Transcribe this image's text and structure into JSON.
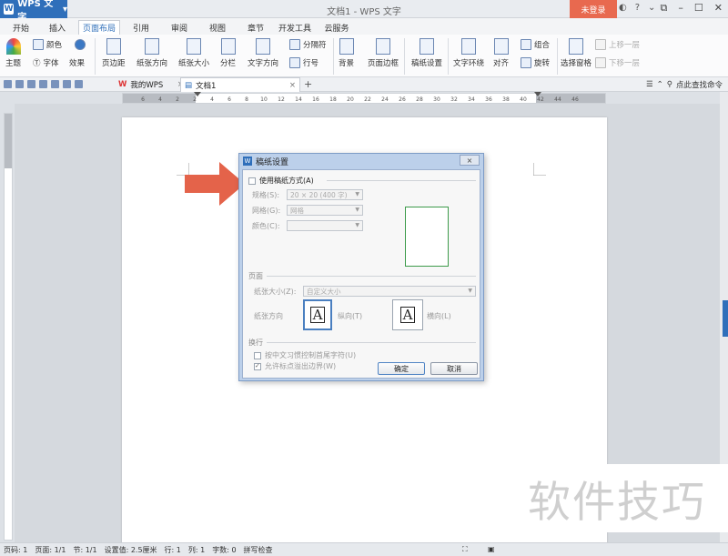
{
  "app": {
    "name": "WPS 文字",
    "window_title": "文档1 - WPS 文字",
    "login": "未登录"
  },
  "menu": {
    "tabs": [
      "开始",
      "插入",
      "页面布局",
      "引用",
      "审阅",
      "视图",
      "章节",
      "开发工具",
      "云服务"
    ],
    "active": "页面布局"
  },
  "ribbon": {
    "theme": "主题",
    "colors": "颜色",
    "fonts": "字体",
    "effects": "效果",
    "margins": "页边距",
    "orientation": "纸张方向",
    "size": "纸张大小",
    "columns": "分栏",
    "text_direction": "文字方向",
    "page_break": "分隔符",
    "line_numbers": "行号",
    "background": "背景",
    "page_border": "页面边框",
    "draft_paper": "稿纸设置",
    "wrap_text": "文字环绕",
    "align": "对齐",
    "group": "组合",
    "rotate": "旋转",
    "selection_pane": "选择窗格",
    "bring_forward": "上移一层",
    "send_backward": "下移一层"
  },
  "tabs_bar": {
    "mywps": "我的WPS",
    "doc": "文档1",
    "search_cmd": "点此查找命令"
  },
  "ruler_labels": [
    "6",
    "4",
    "2",
    "2",
    "4",
    "6",
    "8",
    "10",
    "12",
    "14",
    "16",
    "18",
    "20",
    "22",
    "24",
    "26",
    "28",
    "30",
    "32",
    "34",
    "36",
    "38",
    "40",
    "42",
    "44",
    "46"
  ],
  "dialog": {
    "title": "稿纸设置",
    "use_paper": "使用稿纸方式(A)",
    "spec_label": "规格(S):",
    "spec_value": "20 × 20 (400 字)",
    "grid_label": "网格(G):",
    "grid_value": "网格",
    "color_label": "颜色(C):",
    "page_section": "页面",
    "paper_size_label": "纸张大小(Z):",
    "paper_size_value": "自定义大小",
    "orientation_label": "纸张方向",
    "portrait": "纵向(T)",
    "landscape": "横向(L)",
    "wrap_section": "换行",
    "opt1": "按中文习惯控制首尾字符(U)",
    "opt2": "允许标点溢出边界(W)",
    "ok": "确定",
    "cancel": "取消",
    "close": "×"
  },
  "status": {
    "page_num": "页码: 1",
    "pages": "页面: 1/1",
    "section": "节: 1/1",
    "setting": "设置值: 2.5厘米",
    "line": "行: 1",
    "col": "列: 1",
    "words": "字数: 0",
    "spellcheck": "拼写检查"
  },
  "watermark": "软件技巧",
  "colors": {
    "accent": "#2f6fba",
    "login": "#e8694f",
    "arrow": "#e4634a",
    "preview_border": "#3c9a4a"
  }
}
